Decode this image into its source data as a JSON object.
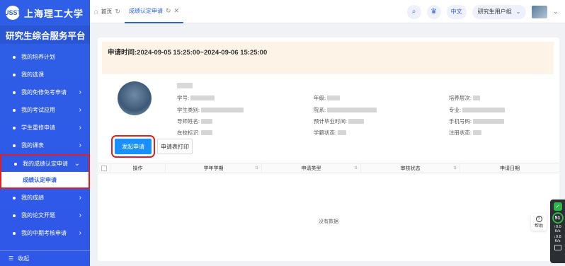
{
  "sidebar": {
    "university": "上海理工大学",
    "seal": "USST",
    "platform": "研究生综合服务平台",
    "items": [
      {
        "label": "我的培养计划",
        "chevron": false
      },
      {
        "label": "我的选课",
        "chevron": false
      },
      {
        "label": "我的免修免考申请",
        "chevron": true
      },
      {
        "label": "我的考试应用",
        "chevron": true
      },
      {
        "label": "学生重修申请",
        "chevron": true
      },
      {
        "label": "我的课表",
        "chevron": true
      },
      {
        "label": "我的成绩认定申请",
        "chevron": true,
        "open": true
      }
    ],
    "sub_item": "成绩认定申请",
    "items_after": [
      {
        "label": "我的成绩",
        "chevron": true
      },
      {
        "label": "我的论文开题",
        "chevron": true
      },
      {
        "label": "我的中期考核申请",
        "chevron": true
      }
    ],
    "collapse_label": "收起"
  },
  "topbar": {
    "tabs": [
      {
        "label": "首页"
      },
      {
        "label": "成绩认定申请"
      }
    ],
    "lang": "中文",
    "role": "研究生用户组"
  },
  "banner": {
    "label": "申请时间:",
    "value": "2024-09-05 15:25:00~2024-09-06 15:25:00"
  },
  "info": {
    "student_id_label": "学号:",
    "grade_label": "年级:",
    "level_label": "培养层次:",
    "category_label": "学生类别:",
    "department_label": "院系:",
    "major_label": "专业:",
    "advisor_label": "导师姓名:",
    "graduation_label": "预计毕业时间:",
    "phone_label": "手机号码:",
    "enrolled_label": "在校标识:",
    "status_label": "学籍状态:",
    "registration_label": "注册状态:"
  },
  "buttons": {
    "apply": "发起申请",
    "print": "申请表打印"
  },
  "table": {
    "columns": [
      "操作",
      "学年学期",
      "申请类型",
      "审核状态",
      "申请日期"
    ],
    "empty_text": "没有数据"
  },
  "help": {
    "label": "帮助"
  },
  "meter": {
    "score": "51",
    "up_value": "0.0",
    "up_unit": "K/s",
    "down_value": "0.8",
    "down_unit": "K/s"
  },
  "colors": {
    "sidebar": "#2e5fe6",
    "primary": "#1890ff",
    "highlight": "#e02020",
    "banner": "#fdf3e6"
  }
}
